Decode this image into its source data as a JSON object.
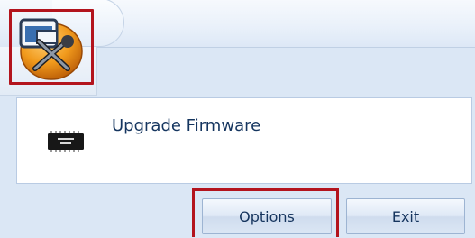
{
  "app_menu": {
    "orb_icon": "firmware-tools-icon",
    "items": [
      {
        "label": "Upgrade Firmware",
        "icon": "chip-icon"
      }
    ]
  },
  "footer": {
    "options_label": "Options",
    "exit_label": "Exit"
  },
  "colors": {
    "highlight": "#b3141d",
    "orb_orange": "#f19a1c",
    "text": "#15355f",
    "panel_bg": "#dbe7f5"
  }
}
